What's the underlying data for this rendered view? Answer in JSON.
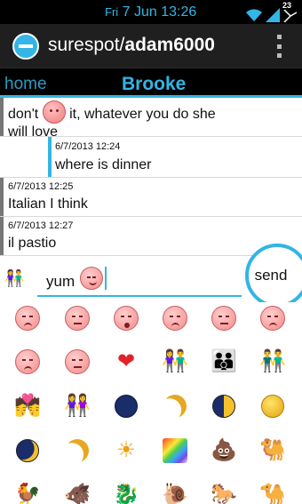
{
  "status_bar": {
    "day": "Fri",
    "date_time": "7 Jun 13:26",
    "battery_level": "23",
    "accent_color": "#33b5e5"
  },
  "action_bar": {
    "app_name": "surespot",
    "separator": "/",
    "username": "adam6000",
    "logo_icon": "surespot-logo-icon",
    "menu_icon": "overflow-menu-icon"
  },
  "tabs": {
    "home": "home",
    "active": "Brooke"
  },
  "messages": [
    {
      "timestamp": "",
      "text_before": "don't",
      "text_after": "it, whatever you do she",
      "text_line2": "will love",
      "emoji": "face-emoji-icon",
      "side": "left"
    },
    {
      "timestamp": "6/7/2013 12:24",
      "text": "where is dinner",
      "side": "right"
    },
    {
      "timestamp": "6/7/2013 12:25",
      "text": "Italian I think",
      "side": "left"
    },
    {
      "timestamp": "6/7/2013 12:27",
      "text": "il pastio",
      "side": "left"
    }
  ],
  "compose": {
    "value": "yum",
    "emoji": "smile-emoji-icon",
    "avatar_icon": "couple-emoji-icon",
    "send_label": "send"
  },
  "emoji_rows": [
    [
      "face-frown",
      "face-neutral",
      "face-open",
      "face-frown",
      "face-sleepy",
      "face-frown"
    ],
    [
      "face-angry",
      "face-neutral",
      "heart",
      "couple",
      "family",
      "couple"
    ],
    [
      "kiss-couple",
      "couple",
      "moon-new",
      "moon-crescent",
      "moon-half",
      "moon-full"
    ],
    [
      "moon-waxing",
      "moon-crescent",
      "sun-face",
      "rainbow",
      "poop",
      "camel"
    ],
    [
      "rooster",
      "boar",
      "dragon",
      "snail",
      "horse",
      "dromedary"
    ]
  ]
}
